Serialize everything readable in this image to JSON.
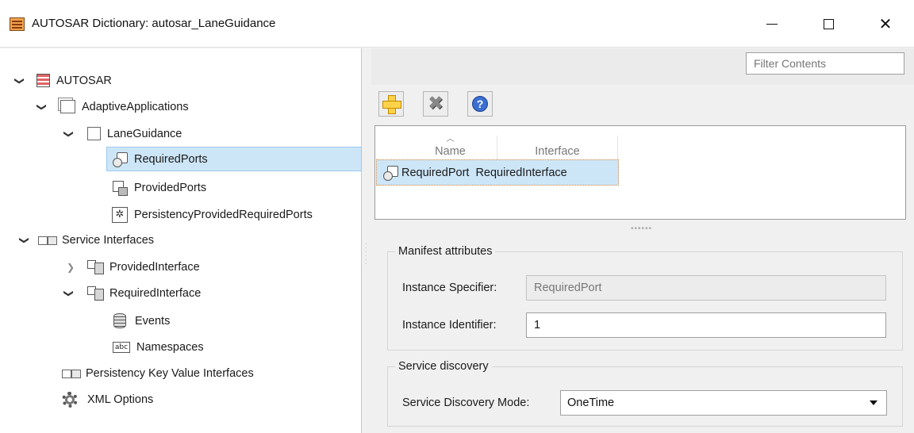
{
  "window": {
    "title": "AUTOSAR Dictionary: autosar_LaneGuidance",
    "close_glyph": "✕"
  },
  "tree": {
    "items": [
      {
        "label": "AUTOSAR",
        "icon": "autosar-icon",
        "expanded": true
      },
      {
        "label": "AdaptiveApplications",
        "icon": "package-icon",
        "expanded": true
      },
      {
        "label": "LaneGuidance",
        "icon": "component-icon",
        "expanded": true
      },
      {
        "label": "RequiredPorts",
        "icon": "required-port-icon",
        "selected": true
      },
      {
        "label": "ProvidedPorts",
        "icon": "provided-port-icon"
      },
      {
        "label": "PersistencyProvidedRequiredPorts",
        "icon": "persistency-port-icon",
        "icon_glyph": "✲"
      },
      {
        "label": "Service Interfaces",
        "icon": "service-interfaces-icon",
        "expanded": true
      },
      {
        "label": "ProvidedInterface",
        "icon": "interface-icon",
        "expanded": false
      },
      {
        "label": "RequiredInterface",
        "icon": "interface-icon",
        "expanded": true
      },
      {
        "label": "Events",
        "icon": "events-icon"
      },
      {
        "label": "Namespaces",
        "icon": "namespaces-icon",
        "icon_text": "abc"
      },
      {
        "label": "Persistency Key Value Interfaces",
        "icon": "persistency-interfaces-icon"
      },
      {
        "label": "XML Options",
        "icon": "gear-icon"
      }
    ],
    "chevron_expanded": "❯",
    "chevron_collapsed": "❯"
  },
  "filter": {
    "placeholder": "Filter Contents"
  },
  "toolbar": {
    "help_glyph": "?",
    "delete_glyph": "✖"
  },
  "table": {
    "sort_glyph": "︿",
    "columns": [
      "Name",
      "Interface"
    ],
    "rows": [
      {
        "name": "RequiredPort",
        "interface": "RequiredInterface"
      }
    ],
    "splitter_glyph": "••••••"
  },
  "manifest": {
    "legend": "Manifest attributes",
    "instance_specifier_label": "Instance Specifier:",
    "instance_specifier_value": "RequiredPort",
    "instance_identifier_label": "Instance Identifier:",
    "instance_identifier_value": "1"
  },
  "service_discovery": {
    "legend": "Service discovery",
    "mode_label": "Service Discovery Mode:",
    "mode_value": "OneTime"
  },
  "colors": {
    "selection": "#cde6f7",
    "selection_border": "#99c9ef",
    "focus_outline": "#e08a3c"
  }
}
